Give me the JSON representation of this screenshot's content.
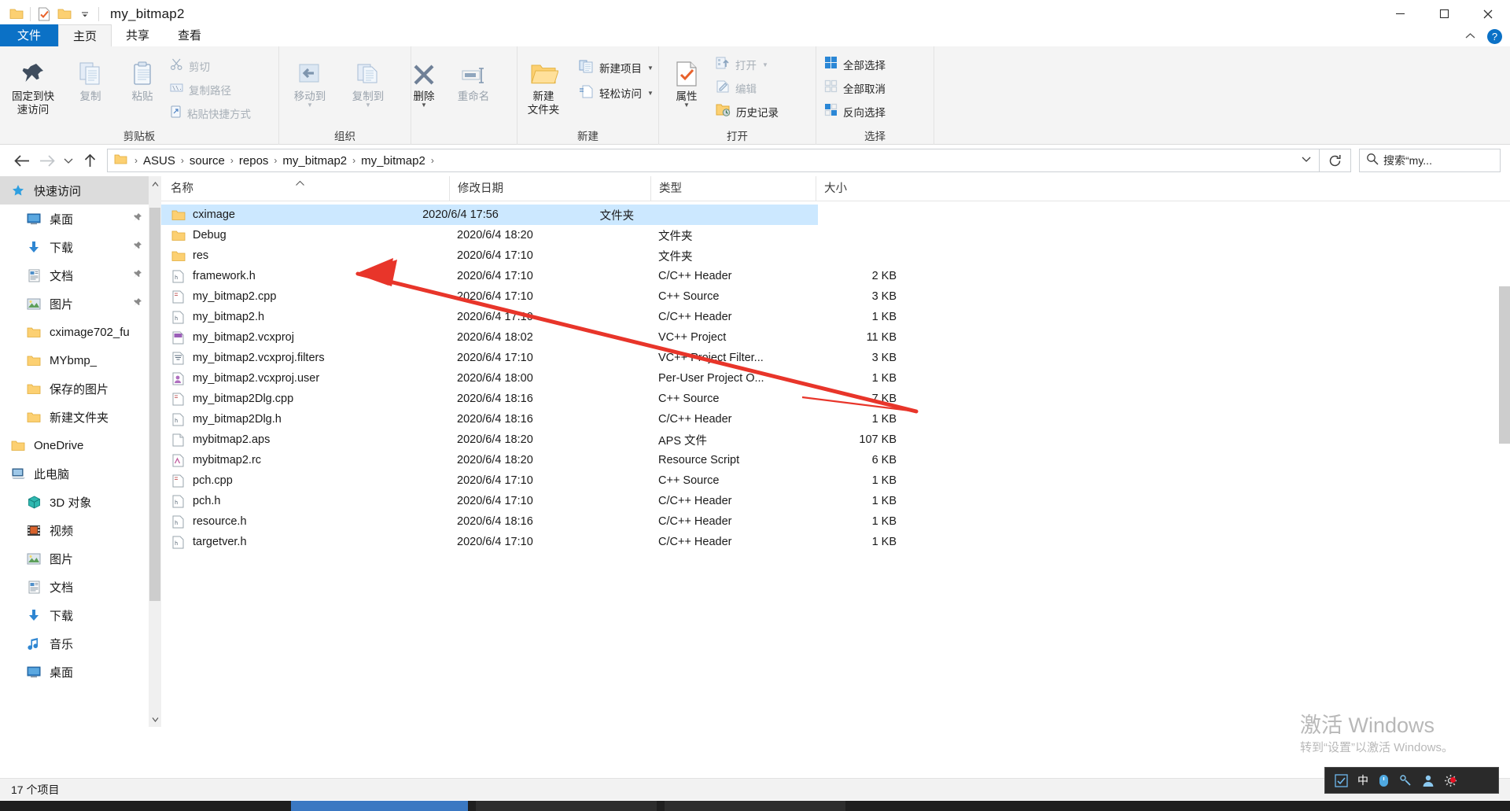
{
  "window": {
    "title": "my_bitmap2",
    "quick_access_icons": [
      "folder-icon",
      "properties-check-icon",
      "folder-icon"
    ],
    "qat_dropdown": "chevron-down-icon",
    "minimize_label": "—",
    "maximize_label": "❐",
    "close_label": "✕"
  },
  "tabs": [
    {
      "label": "文件",
      "name": "tab-file",
      "style": "file"
    },
    {
      "label": "主页",
      "name": "tab-home",
      "style": "active"
    },
    {
      "label": "共享",
      "name": "tab-share",
      "style": ""
    },
    {
      "label": "查看",
      "name": "tab-view",
      "style": ""
    }
  ],
  "tab_right": {
    "collapse_icon": "chevron-up-icon",
    "help_icon": "help-icon",
    "help_label": "?"
  },
  "ribbon": {
    "groups": [
      {
        "label": "剪贴板",
        "name": "ribbon-group-clipboard"
      },
      {
        "label": "组织",
        "name": "ribbon-group-organize"
      },
      {
        "label": "新建",
        "name": "ribbon-group-new"
      },
      {
        "label": "打开",
        "name": "ribbon-group-open"
      },
      {
        "label": "选择",
        "name": "ribbon-group-select"
      }
    ],
    "clipboard": {
      "pin": {
        "line1": "固定到快",
        "line2": "速访问",
        "icon": "pin-icon"
      },
      "copy": {
        "label": "复制",
        "icon": "copy-icon"
      },
      "paste": {
        "label": "粘贴",
        "icon": "paste-icon"
      },
      "cut": {
        "label": "剪切",
        "icon": "scissors-icon"
      },
      "copy_path": {
        "label": "复制路径",
        "icon": "copy-path-icon"
      },
      "paste_shortcut": {
        "label": "粘贴快捷方式",
        "icon": "paste-shortcut-icon"
      }
    },
    "organize": {
      "move_to": {
        "label": "移动到",
        "icon": "move-to-icon"
      },
      "copy_to": {
        "label": "复制到",
        "icon": "copy-to-icon"
      },
      "delete": {
        "label": "删除",
        "icon": "delete-x-icon"
      },
      "rename": {
        "label": "重命名",
        "icon": "rename-icon"
      }
    },
    "new": {
      "new_folder": {
        "line1": "新建",
        "line2": "文件夹",
        "icon": "new-folder-icon"
      },
      "new_item": {
        "label": "新建项目",
        "icon": "new-item-icon"
      },
      "easy_access": {
        "label": "轻松访问",
        "icon": "easy-access-icon"
      }
    },
    "open": {
      "properties": {
        "label": "属性",
        "icon": "properties-icon"
      },
      "open": {
        "label": "打开",
        "icon": "open-icon"
      },
      "edit": {
        "label": "编辑",
        "icon": "edit-icon"
      },
      "history": {
        "label": "历史记录",
        "icon": "history-icon"
      }
    },
    "select": {
      "select_all": {
        "label": "全部选择",
        "icon": "select-all-icon"
      },
      "select_none": {
        "label": "全部取消",
        "icon": "select-none-icon"
      },
      "invert": {
        "label": "反向选择",
        "icon": "invert-selection-icon"
      }
    }
  },
  "address": {
    "back_icon": "back-arrow-icon",
    "forward_icon": "forward-arrow-icon",
    "recent_icon": "chevron-down-icon",
    "up_icon": "up-arrow-icon",
    "folder_icon": "folder-icon",
    "crumbs": [
      "ASUS",
      "source",
      "repos",
      "my_bitmap2",
      "my_bitmap2"
    ],
    "separator": "›",
    "dropdown_icon": "chevron-down-icon",
    "refresh_icon": "refresh-icon",
    "search_icon": "search-icon",
    "search_placeholder": "搜索“my..."
  },
  "nav_pane": {
    "items": [
      {
        "label": "快速访问",
        "icon": "star-pin-icon",
        "indent": 0,
        "selected": true,
        "pinned": false
      },
      {
        "label": "桌面",
        "icon": "desktop-icon",
        "indent": 1,
        "selected": false,
        "pinned": true
      },
      {
        "label": "下载",
        "icon": "download-icon",
        "indent": 1,
        "selected": false,
        "pinned": true
      },
      {
        "label": "文档",
        "icon": "documents-icon",
        "indent": 1,
        "selected": false,
        "pinned": true
      },
      {
        "label": "图片",
        "icon": "pictures-icon",
        "indent": 1,
        "selected": false,
        "pinned": true
      },
      {
        "label": "cximage702_fu",
        "icon": "folder-icon",
        "indent": 1,
        "selected": false,
        "pinned": false
      },
      {
        "label": "MYbmp_",
        "icon": "folder-icon",
        "indent": 1,
        "selected": false,
        "pinned": false
      },
      {
        "label": "保存的图片",
        "icon": "folder-icon",
        "indent": 1,
        "selected": false,
        "pinned": false
      },
      {
        "label": "新建文件夹",
        "icon": "folder-icon",
        "indent": 1,
        "selected": false,
        "pinned": false
      },
      {
        "label": "OneDrive",
        "icon": "onedrive-folder-icon",
        "indent": 0,
        "selected": false,
        "pinned": false
      },
      {
        "label": "此电脑",
        "icon": "this-pc-icon",
        "indent": 0,
        "selected": false,
        "pinned": false
      },
      {
        "label": "3D 对象",
        "icon": "3d-objects-icon",
        "indent": 1,
        "selected": false,
        "pinned": false
      },
      {
        "label": "视频",
        "icon": "videos-icon",
        "indent": 1,
        "selected": false,
        "pinned": false
      },
      {
        "label": "图片",
        "icon": "pictures-icon",
        "indent": 1,
        "selected": false,
        "pinned": false
      },
      {
        "label": "文档",
        "icon": "documents-icon",
        "indent": 1,
        "selected": false,
        "pinned": false
      },
      {
        "label": "下载",
        "icon": "download-icon",
        "indent": 1,
        "selected": false,
        "pinned": false
      },
      {
        "label": "音乐",
        "icon": "music-icon",
        "indent": 1,
        "selected": false,
        "pinned": false
      },
      {
        "label": "桌面",
        "icon": "desktop-icon",
        "indent": 1,
        "selected": false,
        "pinned": false
      }
    ]
  },
  "file_list": {
    "columns": [
      {
        "label": "名称",
        "key": "name",
        "sorted": true,
        "sort_icon": "sort-asc-icon"
      },
      {
        "label": "修改日期",
        "key": "date",
        "sorted": false
      },
      {
        "label": "类型",
        "key": "type",
        "sorted": false
      },
      {
        "label": "大小",
        "key": "size",
        "sorted": false
      }
    ],
    "rows": [
      {
        "name": "cximage",
        "date": "2020/6/4 17:56",
        "type": "文件夹",
        "size": "",
        "icon": "folder-icon",
        "selected": true
      },
      {
        "name": "Debug",
        "date": "2020/6/4 18:20",
        "type": "文件夹",
        "size": "",
        "icon": "folder-icon",
        "selected": false
      },
      {
        "name": "res",
        "date": "2020/6/4 17:10",
        "type": "文件夹",
        "size": "",
        "icon": "folder-icon",
        "selected": false
      },
      {
        "name": "framework.h",
        "date": "2020/6/4 17:10",
        "type": "C/C++ Header",
        "size": "2 KB",
        "icon": "header-file-icon",
        "selected": false
      },
      {
        "name": "my_bitmap2.cpp",
        "date": "2020/6/4 17:10",
        "type": "C++ Source",
        "size": "3 KB",
        "icon": "cpp-file-icon",
        "selected": false
      },
      {
        "name": "my_bitmap2.h",
        "date": "2020/6/4 17:10",
        "type": "C/C++ Header",
        "size": "1 KB",
        "icon": "header-file-icon",
        "selected": false
      },
      {
        "name": "my_bitmap2.vcxproj",
        "date": "2020/6/4 18:02",
        "type": "VC++ Project",
        "size": "11 KB",
        "icon": "vcxproj-file-icon",
        "selected": false
      },
      {
        "name": "my_bitmap2.vcxproj.filters",
        "date": "2020/6/4 17:10",
        "type": "VC++ Project Filter...",
        "size": "3 KB",
        "icon": "filters-file-icon",
        "selected": false
      },
      {
        "name": "my_bitmap2.vcxproj.user",
        "date": "2020/6/4 18:00",
        "type": "Per-User Project O...",
        "size": "1 KB",
        "icon": "user-file-icon",
        "selected": false
      },
      {
        "name": "my_bitmap2Dlg.cpp",
        "date": "2020/6/4 18:16",
        "type": "C++ Source",
        "size": "7 KB",
        "icon": "cpp-file-icon",
        "selected": false
      },
      {
        "name": "my_bitmap2Dlg.h",
        "date": "2020/6/4 18:16",
        "type": "C/C++ Header",
        "size": "1 KB",
        "icon": "header-file-icon",
        "selected": false
      },
      {
        "name": "mybitmap2.aps",
        "date": "2020/6/4 18:20",
        "type": "APS 文件",
        "size": "107 KB",
        "icon": "generic-file-icon",
        "selected": false
      },
      {
        "name": "mybitmap2.rc",
        "date": "2020/6/4 18:20",
        "type": "Resource Script",
        "size": "6 KB",
        "icon": "rc-file-icon",
        "selected": false
      },
      {
        "name": "pch.cpp",
        "date": "2020/6/4 17:10",
        "type": "C++ Source",
        "size": "1 KB",
        "icon": "cpp-file-icon",
        "selected": false
      },
      {
        "name": "pch.h",
        "date": "2020/6/4 17:10",
        "type": "C/C++ Header",
        "size": "1 KB",
        "icon": "header-file-icon",
        "selected": false
      },
      {
        "name": "resource.h",
        "date": "2020/6/4 18:16",
        "type": "C/C++ Header",
        "size": "1 KB",
        "icon": "header-file-icon",
        "selected": false
      },
      {
        "name": "targetver.h",
        "date": "2020/6/4 17:10",
        "type": "C/C++ Header",
        "size": "1 KB",
        "icon": "header-file-icon",
        "selected": false
      }
    ]
  },
  "status_bar": {
    "item_count": "17 个项目"
  },
  "watermark": {
    "line1": "激活 Windows",
    "line2": "转到“设置”以激活 Windows。"
  },
  "tray": {
    "items": [
      {
        "icon": "ime-box-icon",
        "label": ""
      },
      {
        "icon": "ime-chinese-icon",
        "label": "中"
      },
      {
        "icon": "ime-mouse-icon",
        "label": ""
      },
      {
        "icon": "ime-tools-icon",
        "label": ""
      },
      {
        "icon": "ime-user-icon",
        "label": ""
      },
      {
        "icon": "ime-settings-icon",
        "label": ""
      }
    ]
  },
  "annotation": {
    "type": "red-arrow",
    "color": "#e8352a"
  },
  "colors": {
    "accent": "#0b71c6",
    "selection": "#cce8ff",
    "ribbon_bg": "#f4f4f4",
    "folder": "#fcd072"
  }
}
